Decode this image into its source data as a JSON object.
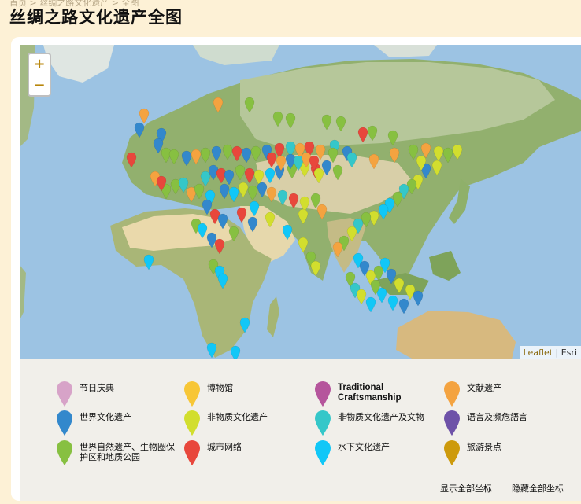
{
  "breadcrumb": "首页 > 丝绸之路文化遗产 > 全图",
  "page_title": "丝绸之路文化遗产全图",
  "map": {
    "zoom_in": "+",
    "zoom_out": "−",
    "attribution_leaflet": "Leaflet",
    "attribution_sep": " | ",
    "attribution_esri": "Esri"
  },
  "legend": {
    "items": [
      {
        "label": "节日庆典",
        "color": "#d7a3c8"
      },
      {
        "label": "博物馆",
        "color": "#f7c636"
      },
      {
        "label": "Traditional Craftsmanship",
        "color": "#b5559c"
      },
      {
        "label": "文献遗产",
        "color": "#f4a340"
      },
      {
        "label": "世界文化遗产",
        "color": "#3388cc"
      },
      {
        "label": "非物质文化遗产",
        "color": "#d2de2e"
      },
      {
        "label": "非物质文化遗产及文物",
        "color": "#35c7c9"
      },
      {
        "label": "语言及濒危語言",
        "color": "#6e52a8"
      },
      {
        "label": "世界自然遗产、生物圈保护区和地质公园",
        "color": "#87c041"
      },
      {
        "label": "城市网络",
        "color": "#e8473c"
      },
      {
        "label": "水下文化遗产",
        "color": "#11c7f7"
      },
      {
        "label": "旅游景点",
        "color": "#cd9a0c"
      }
    ],
    "show_all": "显示全部坐标",
    "hide_all": "隐藏全部坐标"
  }
}
